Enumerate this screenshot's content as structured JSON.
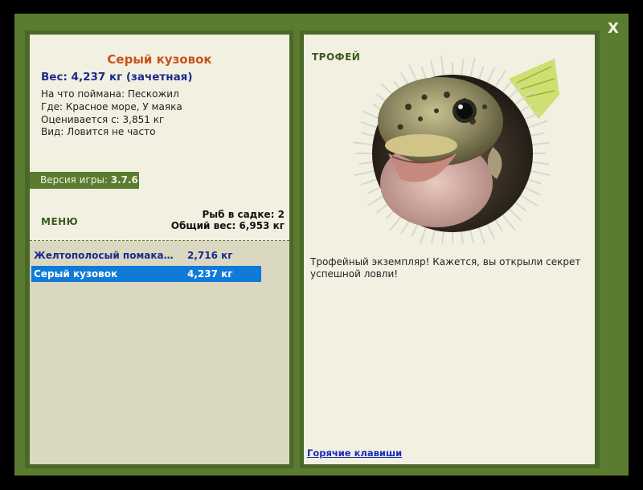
{
  "close_label": "X",
  "fish": {
    "title": "Серый кузовок",
    "weight_line": "Вес: 4,237 кг (зачетная)",
    "bait": "На что поймана: Пескожил",
    "location": "Где: Красное море, У маяка",
    "value": "Оценивается с: 3,851 кг",
    "frequency": "Вид: Ловится не часто"
  },
  "version": {
    "label": "Версия игры: ",
    "value": "3.7.6"
  },
  "menu_label": "МЕНЮ",
  "cage": {
    "count_line": "Рыб в садке: 2",
    "total_line": "Общий вес: 6,953 кг"
  },
  "catch_list": [
    {
      "name": "Желтополосый помакан...",
      "weight": "2,716 кг",
      "selected": false
    },
    {
      "name": "Серый кузовок",
      "weight": "4,237 кг",
      "selected": true
    }
  ],
  "trophy_label": "ТРОФЕЙ",
  "trophy_description": "Трофейный экземпляр! Кажется, вы открыли секрет успешной ловли!",
  "hotkeys_link": "Горячие клавиши",
  "colors": {
    "frame": "#5b7b30",
    "panel_bg": "#f1f0e1",
    "list_bg": "#dbd8c2",
    "selection": "#0f7ad8",
    "title_orange": "#c8521c",
    "text_navy": "#1c2a8c"
  }
}
